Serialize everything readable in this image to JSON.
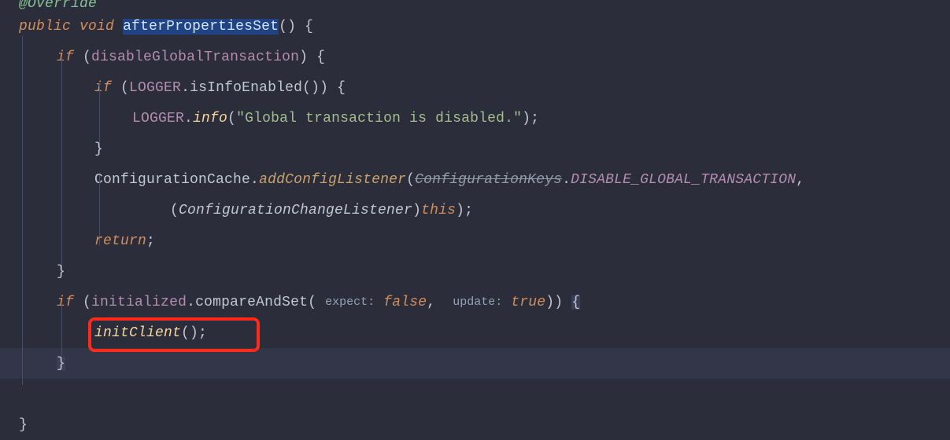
{
  "code": {
    "annotation": "@Override",
    "sig": {
      "mod1": "public",
      "mod2": "void",
      "name": "afterPropertiesSet"
    },
    "if1": {
      "kw": "if",
      "cond": "disableGlobalTransaction"
    },
    "if2": {
      "kw": "if",
      "obj": "LOGGER",
      "call": "isInfoEnabled"
    },
    "log": {
      "obj": "LOGGER",
      "call": "info",
      "str": "\"Global transaction is disabled.\""
    },
    "cfg": {
      "cls": "ConfigurationCache",
      "call": "addConfigListener",
      "deprec_cls": "ConfigurationKeys",
      "const": "DISABLE_GLOBAL_TRANSACTION"
    },
    "cast": {
      "type": "ConfigurationChangeListener",
      "this": "this"
    },
    "ret": "return",
    "if3": {
      "kw": "if",
      "obj": "initialized",
      "call": "compareAndSet",
      "hint1": "expect:",
      "arg1": "false",
      "hint2": "update:",
      "arg2": "true"
    },
    "init_call": "initClient"
  },
  "colors": {
    "selection": "#214283",
    "highlight_box": "#ff2a1a"
  }
}
